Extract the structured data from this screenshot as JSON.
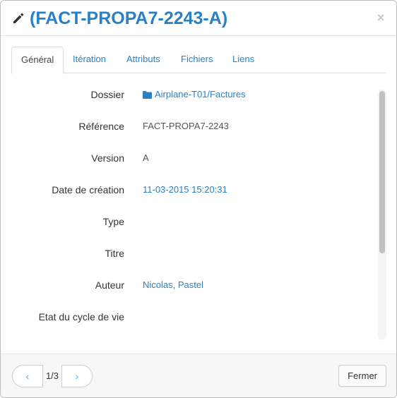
{
  "header": {
    "title": "(FACT-PROPA7-2243-A)",
    "icon": "pencil-icon",
    "close_label": "×"
  },
  "tabs": [
    {
      "label": "Général",
      "active": true
    },
    {
      "label": "Itération",
      "active": false
    },
    {
      "label": "Attributs",
      "active": false
    },
    {
      "label": "Fichiers",
      "active": false
    },
    {
      "label": "Liens",
      "active": false
    }
  ],
  "fields": [
    {
      "label": "Dossier",
      "value": "Airplane-T01/Factures",
      "link": true,
      "icon": "folder-icon"
    },
    {
      "label": "Référence",
      "value": "FACT-PROPA7-2243",
      "link": false
    },
    {
      "label": "Version",
      "value": "A",
      "link": false
    },
    {
      "label": "Date de création",
      "value": "11-03-2015 15:20:31",
      "link": true
    },
    {
      "label": "Type",
      "value": "",
      "link": false
    },
    {
      "label": "Titre",
      "value": "",
      "link": false
    },
    {
      "label": "Auteur",
      "value": "Nicolas, Pastel",
      "link": true
    },
    {
      "label": "Etat du cycle de vie",
      "value": "",
      "link": false
    }
  ],
  "footer": {
    "pager_prev": "‹",
    "pager_text": "1/3",
    "pager_next": "›",
    "close_button": "Fermer"
  },
  "colors": {
    "accent": "#2a80c5",
    "text": "#333333",
    "border": "#dddddd"
  }
}
